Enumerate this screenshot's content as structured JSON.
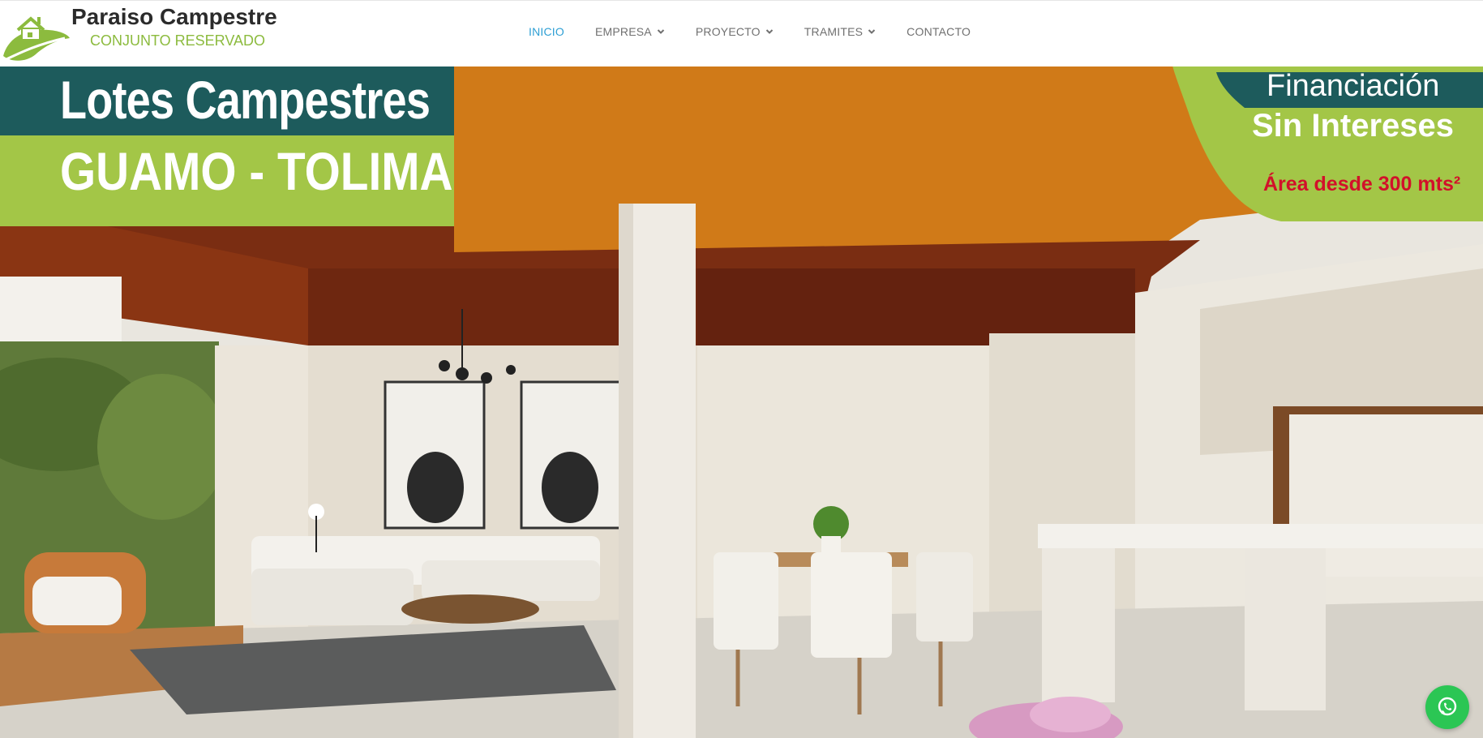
{
  "brand": {
    "title": "Paraiso Campestre",
    "subtitle": "CONJUNTO RESERVADO",
    "logo_icon": "house-leaf-logo",
    "title_color": "#2b2b2b",
    "subtitle_color": "#8cbb3e"
  },
  "nav": {
    "items": [
      {
        "label": "INICIO",
        "active": true,
        "dropdown": false
      },
      {
        "label": "EMPRESA",
        "active": false,
        "dropdown": true
      },
      {
        "label": "PROYECTO",
        "active": false,
        "dropdown": true
      },
      {
        "label": "TRAMITES",
        "active": false,
        "dropdown": true
      },
      {
        "label": "CONTACTO",
        "active": false,
        "dropdown": false
      }
    ],
    "active_color": "#2e9fd4",
    "text_color": "#707070"
  },
  "hero": {
    "banner_left": {
      "line1": "Lotes Campestres",
      "line2": "GUAMO - TOLIMA",
      "top_color": "#1d5b5c",
      "bottom_color": "#a3c647"
    },
    "banner_right": {
      "line1": "Financiación",
      "line2": "Sin Intereses",
      "line3": "Área desde 300 mts²",
      "accent_color": "#d2102a"
    }
  },
  "whatsapp": {
    "icon": "whatsapp-icon",
    "color": "#2bc654"
  }
}
